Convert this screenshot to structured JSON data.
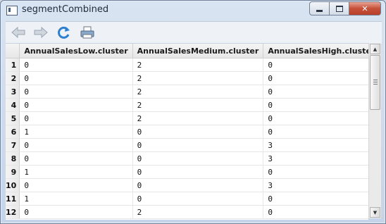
{
  "window": {
    "title": "segmentCombined"
  },
  "toolbar": {
    "buttons": [
      "back-arrow-icon",
      "forward-arrow-icon",
      "refresh-icon",
      "print-icon"
    ]
  },
  "table": {
    "columns": [
      "AnnualSalesLow.cluster",
      "AnnualSalesMedium.cluster",
      "AnnualSalesHigh.cluster"
    ],
    "rows": [
      {
        "id": "1",
        "cells": [
          "0",
          "2",
          "0"
        ]
      },
      {
        "id": "2",
        "cells": [
          "0",
          "2",
          "0"
        ]
      },
      {
        "id": "3",
        "cells": [
          "0",
          "2",
          "0"
        ]
      },
      {
        "id": "4",
        "cells": [
          "0",
          "2",
          "0"
        ]
      },
      {
        "id": "5",
        "cells": [
          "0",
          "2",
          "0"
        ]
      },
      {
        "id": "6",
        "cells": [
          "1",
          "0",
          "0"
        ]
      },
      {
        "id": "7",
        "cells": [
          "0",
          "0",
          "3"
        ]
      },
      {
        "id": "8",
        "cells": [
          "0",
          "0",
          "3"
        ]
      },
      {
        "id": "9",
        "cells": [
          "1",
          "0",
          "0"
        ]
      },
      {
        "id": "10",
        "cells": [
          "0",
          "0",
          "3"
        ]
      },
      {
        "id": "11",
        "cells": [
          "1",
          "0",
          "0"
        ]
      },
      {
        "id": "12",
        "cells": [
          "0",
          "2",
          "0"
        ]
      }
    ]
  }
}
